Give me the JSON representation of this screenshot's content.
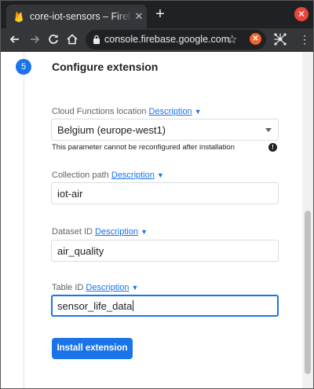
{
  "browser": {
    "tab_title": "core-iot-sensors – Firebase",
    "tab_close_glyph": "✕",
    "new_tab_glyph": "+",
    "window_close_glyph": "✕",
    "url": "console.firebase.google.com/…",
    "star_glyph": "☆",
    "extension_glyph": "✕",
    "menu_glyph": "⋮",
    "icons": [
      "firebase-icon",
      "back-icon",
      "forward-icon",
      "reload-icon",
      "home-icon",
      "lock-icon",
      "star-icon",
      "extension-icon",
      "network-extension-icon",
      "menu-icon"
    ]
  },
  "step": {
    "number": "5",
    "title": "Configure extension"
  },
  "fields": [
    {
      "label": "Cloud Functions location",
      "link": "Description",
      "value": "Belgium (europe-west1)",
      "type": "select",
      "helper": "This parameter cannot be reconfigured after installation"
    },
    {
      "label": "Collection path",
      "link": "Description",
      "value": "iot-air",
      "type": "text"
    },
    {
      "label": "Dataset ID",
      "link": "Description",
      "value": "air_quality",
      "type": "text"
    },
    {
      "label": "Table ID",
      "link": "Description",
      "value": "sensor_life_data",
      "type": "text",
      "focused": true
    }
  ],
  "caret_glyph": "▼",
  "info_glyph": "!",
  "install_button": "Install extension",
  "colors": {
    "accent": "#1a73e8",
    "chrome_dark": "#202124",
    "chrome_tab": "#35363a"
  }
}
